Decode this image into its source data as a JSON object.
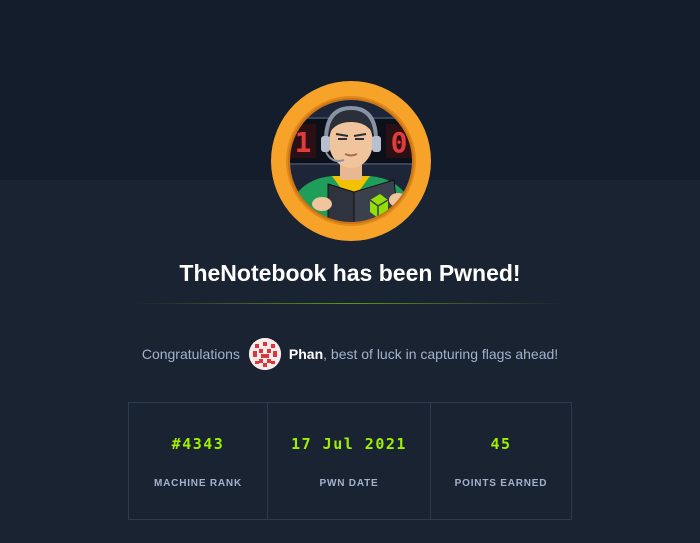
{
  "hero": {
    "title": "TheNotebook has been Pwned!",
    "image": "machine-avatar-hacker-with-notebook",
    "ring_color": "#f7a32a"
  },
  "congrats": {
    "prefix": "Congratulations",
    "username": "Phan",
    "suffix": ", best of luck in capturing flags ahead!",
    "user_avatar": "user-avatar-icon"
  },
  "stats": [
    {
      "value": "#4343",
      "label": "MACHINE RANK"
    },
    {
      "value": "17 Jul 2021",
      "label": "PWN DATE"
    },
    {
      "value": "45",
      "label": "POINTS EARNED"
    }
  ],
  "colors": {
    "accent": "#9fef00",
    "background": "#1a2332",
    "header_band": "#141d2b",
    "muted_text": "#a4b1cd"
  }
}
